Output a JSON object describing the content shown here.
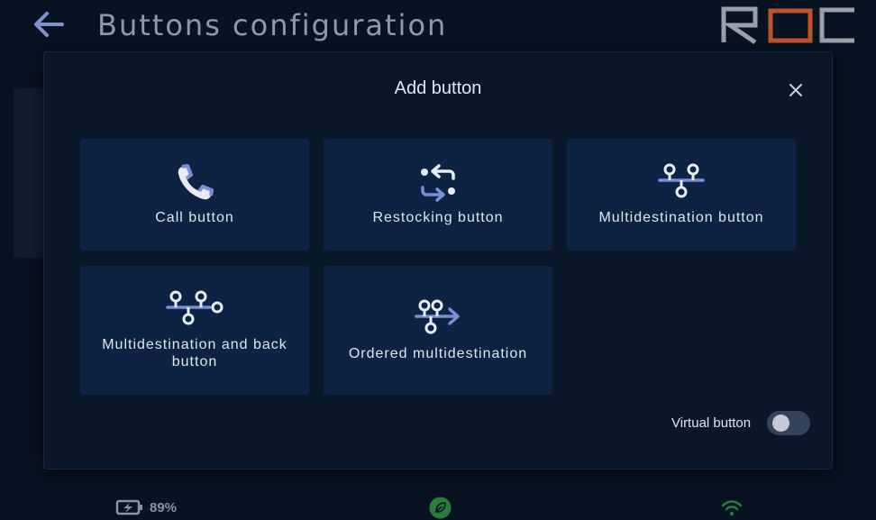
{
  "header": {
    "title": "Buttons configuration",
    "logo_text": "ROC"
  },
  "modal": {
    "title": "Add button",
    "buttons": [
      {
        "label": "Call button",
        "icon": "phone-icon"
      },
      {
        "label": "Restocking button",
        "icon": "restock-icon"
      },
      {
        "label": "Multidestination button",
        "icon": "multidestination-icon"
      },
      {
        "label": "Multidestination and back button",
        "icon": "multidestination-back-icon"
      },
      {
        "label": "Ordered multidestination",
        "icon": "ordered-multidestination-icon"
      }
    ],
    "virtual_button": {
      "label": "Virtual button",
      "on": false
    }
  },
  "status": {
    "battery": "89%"
  },
  "colors": {
    "accent": "#7c8fd6",
    "card": "#0e2343",
    "logo_grey": "#9aa0a8",
    "logo_orange": "#c1532b",
    "eco_green": "#2d7a3f"
  }
}
